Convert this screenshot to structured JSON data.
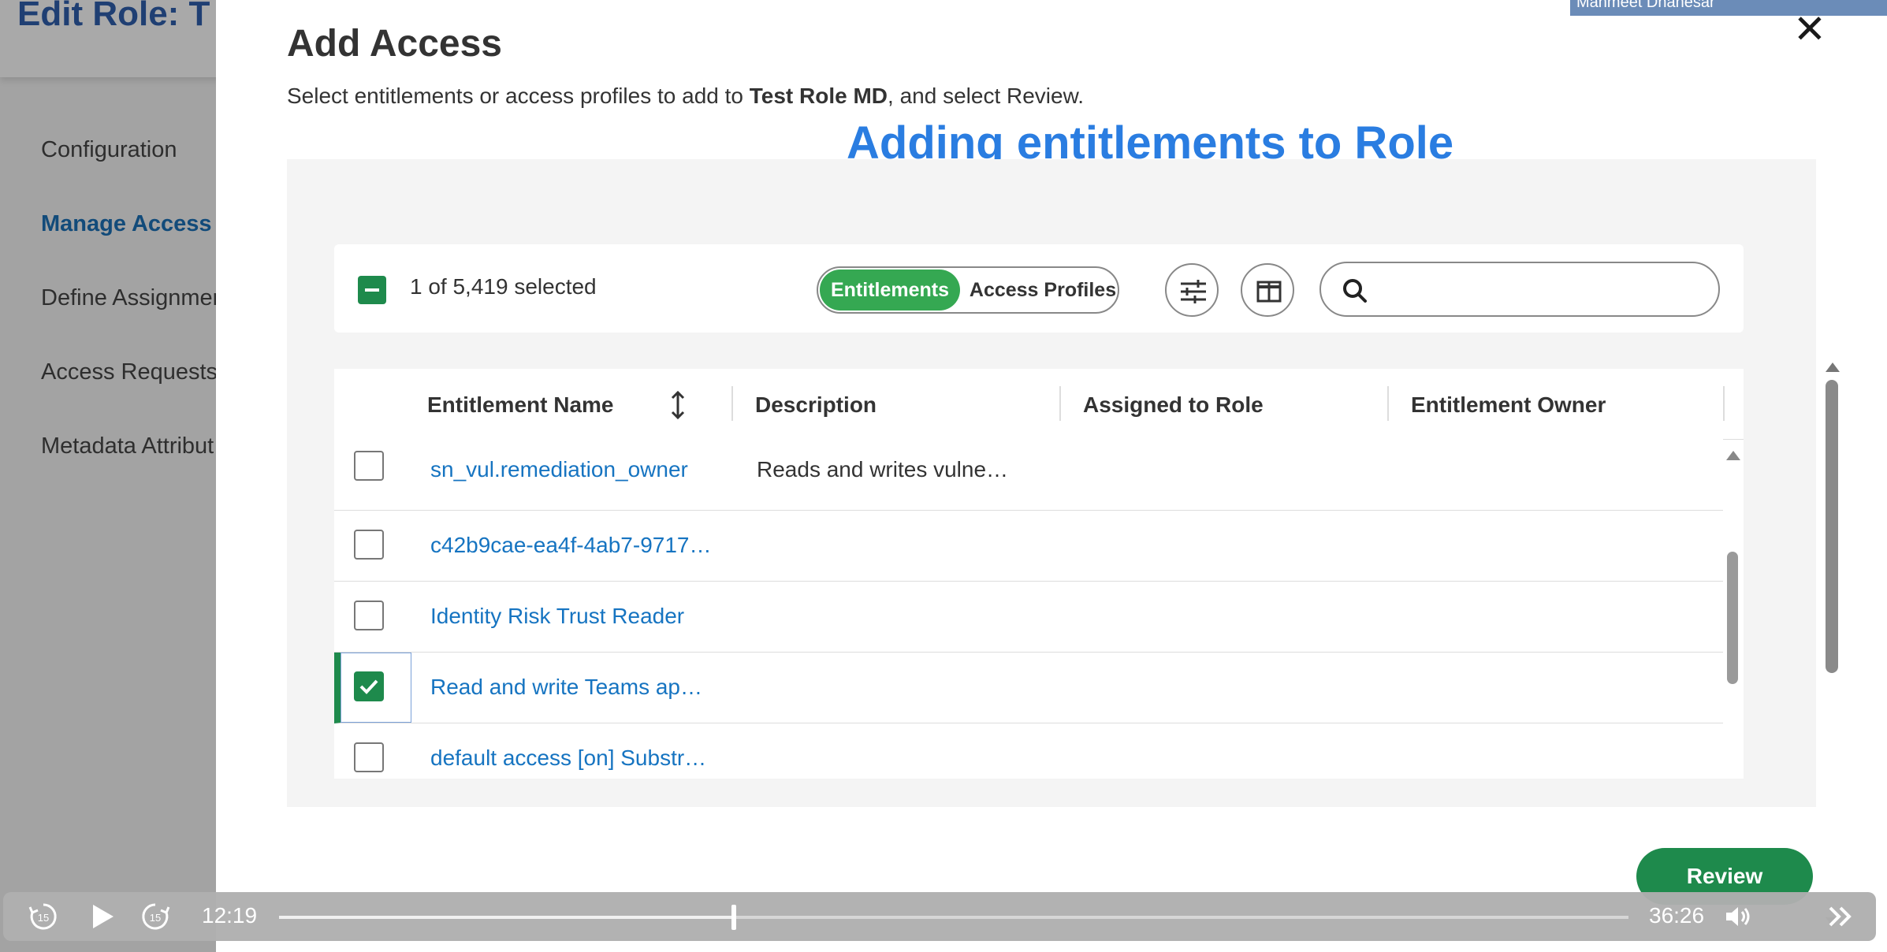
{
  "background": {
    "title": "Edit Role: T",
    "nav": [
      {
        "label": "Configuration",
        "active": false
      },
      {
        "label": "Manage Access",
        "active": true
      },
      {
        "label": "Define Assignmen",
        "active": false
      },
      {
        "label": "Access Requests",
        "active": false
      },
      {
        "label": "Metadata Attribut",
        "active": false
      }
    ]
  },
  "modal": {
    "title": "Add Access",
    "subtitle_prefix": "Select entitlements or access profiles to add to ",
    "subtitle_role": "Test Role MD",
    "subtitle_suffix": ", and select Review.",
    "close_icon": "close-icon",
    "overlay_caption": "Adding entitlements to Role",
    "webcam_name": "Manmeet Dhanesar"
  },
  "toolbar": {
    "selected_count": "1 of 5,419 selected",
    "toggle_active": "Entitlements",
    "toggle_inactive": "Access Profiles",
    "filter_icon": "sliders-icon",
    "columns_icon": "columns-icon",
    "search_placeholder": ""
  },
  "table": {
    "columns": [
      "Entitlement Name",
      "Description",
      "Assigned to Role",
      "Entitlement Owner"
    ],
    "rows": [
      {
        "name": "sn_vul.remediation_owner",
        "description": "Reads and writes vulne…",
        "assigned": "",
        "owner": "",
        "checked": false
      },
      {
        "name": "c42b9cae-ea4f-4ab7-9717…",
        "description": "",
        "assigned": "",
        "owner": "",
        "checked": false
      },
      {
        "name": "Identity Risk Trust Reader",
        "description": "",
        "assigned": "",
        "owner": "",
        "checked": false
      },
      {
        "name": "Read and write Teams ap…",
        "description": "",
        "assigned": "",
        "owner": "",
        "checked": true
      },
      {
        "name": "default access [on] Substr…",
        "description": "",
        "assigned": "",
        "owner": "",
        "checked": false
      }
    ]
  },
  "review_label": "Review",
  "player": {
    "current_time": "12:19",
    "total_time": "36:26",
    "progress": 0.337,
    "skip_back_label": "15",
    "skip_forward_label": "15"
  },
  "colors": {
    "accent_green": "#1e8a4c",
    "toggle_green": "#35a852",
    "link_blue": "#1674c1",
    "caption_blue": "#2a7de1"
  }
}
